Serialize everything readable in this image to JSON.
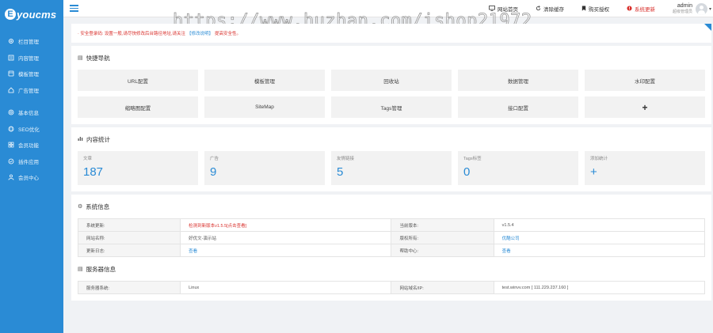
{
  "brand": {
    "mark": "E",
    "name": "youcms"
  },
  "sidebar": {
    "items": [
      {
        "label": "栏目管理",
        "icon": "gear-icon"
      },
      {
        "label": "内容管理",
        "icon": "document-icon"
      },
      {
        "label": "模板管理",
        "icon": "template-icon"
      },
      {
        "label": "广告管理",
        "icon": "home-icon"
      },
      {
        "label": "基本信息",
        "icon": "settings-icon"
      },
      {
        "label": "SEO优化",
        "icon": "globe-icon"
      },
      {
        "label": "会员功能",
        "icon": "grid-icon"
      },
      {
        "label": "插件应用",
        "icon": "plugin-icon"
      },
      {
        "label": "会员中心",
        "icon": "user-icon"
      }
    ]
  },
  "topbar": {
    "actions": [
      {
        "label": "网站首页",
        "icon": "monitor-icon",
        "color": "#333333"
      },
      {
        "label": "清除缓存",
        "icon": "refresh-icon",
        "color": "#333333"
      },
      {
        "label": "购买授权",
        "icon": "bookmark-icon",
        "color": "#333333"
      },
      {
        "label": "系统更新",
        "icon": "alert-icon",
        "color": "#d9302c"
      }
    ],
    "user": {
      "name": "admin",
      "role": "超级管理员"
    }
  },
  "watermark": "https://www.huzhan.com/ishop21972",
  "notice": {
    "prefix": "·  安全登录码: 设置一般,请尽快修改后台路径地址,请关注",
    "link": "【修改说明】",
    "suffix": "提高安全性。"
  },
  "quick_nav": {
    "title": "快捷导航",
    "items": [
      "URL配置",
      "模板管理",
      "回收站",
      "数据管理",
      "水印配置",
      "缩略图配置",
      "SiteMap",
      "Tags管理",
      "接口配置",
      "+"
    ]
  },
  "stats": {
    "title": "内容统计",
    "items": [
      {
        "label": "文章",
        "value": "187"
      },
      {
        "label": "广告",
        "value": "9"
      },
      {
        "label": "友情链接",
        "value": "5"
      },
      {
        "label": "Tags标签",
        "value": "0"
      },
      {
        "label": "添加统计",
        "value": "+"
      }
    ]
  },
  "system_info": {
    "title": "系统信息",
    "rows": [
      {
        "k1": "系统更新:",
        "v1": "检测到新版本v1.5.5[点击查看]",
        "k2": "当前版本:",
        "v2": "v1.5.4"
      },
      {
        "k1": "网站名称:",
        "v1": "好优文-演示站",
        "k2": "版权所有:",
        "v2": "优酷公司"
      },
      {
        "k1": "更新日志:",
        "v1": "查看",
        "k2": "帮助中心:",
        "v2": "查看"
      }
    ]
  },
  "server_info": {
    "title": "服务器信息",
    "rows": [
      {
        "k1": "服务器系统:",
        "v1": "Linux",
        "k2": "网站域名/IP:",
        "v2": "test.winvv.com [ 111.229.237.160 ]"
      }
    ]
  },
  "colors": {
    "accent": "#2a8bd5",
    "danger": "#d9302c",
    "sidebar": "#2a8bd5"
  }
}
